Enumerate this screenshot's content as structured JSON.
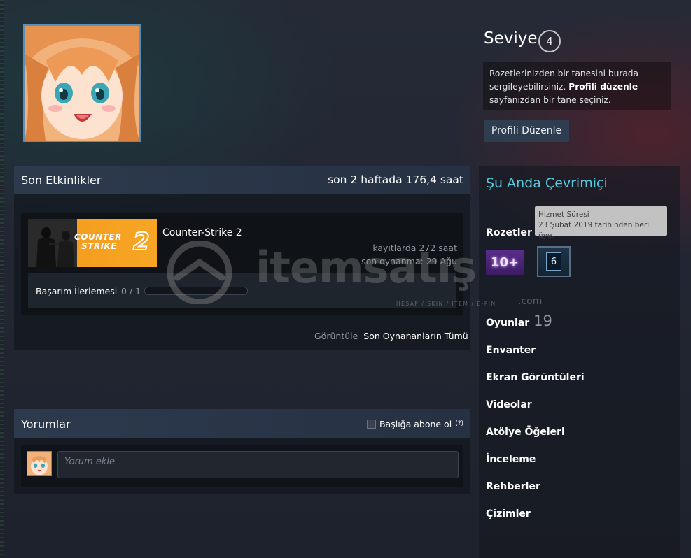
{
  "profile": {
    "avatar_alt": ""
  },
  "level": {
    "title": "Seviye",
    "value": "4"
  },
  "badge_showcase": {
    "text_1": "Rozetlerinizden bir tanesini burada sergileyebilirsiniz. ",
    "link": "Profili düzenle",
    "text_2": " sayfanızdan bir tane seçiniz."
  },
  "edit_profile_label": "Profili Düzenle",
  "activity": {
    "title": "Son Etkinlikler",
    "hours_summary": "son 2 haftada 176,4 saat",
    "game": {
      "name": "Counter-Strike 2",
      "logo_line1": "COUNTER",
      "logo_line2": "STRIKE",
      "logo_num": "2",
      "total_hours": "kayıtlarda 272 saat",
      "last_played": "son oynanma: 29 Ağu",
      "achievements_label": "Başarım İlerlemesi",
      "achievements_count": "0 / 1",
      "achievements_progress": 0
    },
    "view_label": "Görüntüle",
    "view_all_link": "Son Oynananların Tümü"
  },
  "comments": {
    "title": "Yorumlar",
    "subscribe_label": "Başlığa abone ol",
    "help": "(?)",
    "input_placeholder": "Yorum ekle"
  },
  "sidebar": {
    "status": "Şu Anda Çevrimiçi",
    "badges_label": "Rozetler",
    "badges_count": "2",
    "tooltip_title": "Hizmet Süresi",
    "tooltip_text": "23 Şubat 2019 tarihinden beri üye.",
    "badge_years": "10+",
    "badge_level": "6",
    "games_label": "Oyunlar",
    "games_count": "19",
    "links": [
      "Envanter",
      "Ekran Görüntüleri",
      "Videolar",
      "Atölye Öğeleri",
      "İnceleme",
      "Rehberler",
      "Çizimler"
    ]
  },
  "watermark": {
    "brand": "itemsatış",
    "tagline": "HESAP / SKIN / ITEM / E-PIN",
    "domain": ".com"
  },
  "colors": {
    "accent_online": "#57cbde",
    "panel_head": "#2d3a4d",
    "background": "#1b2029"
  }
}
